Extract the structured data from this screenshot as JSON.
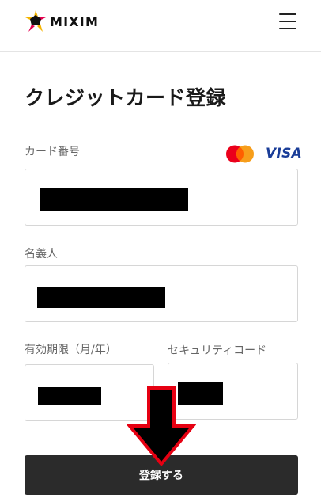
{
  "header": {
    "brand_name": "MIXIM",
    "menu_icon": "hamburger-menu-icon"
  },
  "page": {
    "title": "クレジットカード登録"
  },
  "form": {
    "card_number": {
      "label": "カード番号",
      "value": ""
    },
    "card_brands": {
      "mastercard_icon": "mastercard-logo",
      "visa_label": "VISA"
    },
    "holder_name": {
      "label": "名義人",
      "value": ""
    },
    "expiry": {
      "label": "有効期限（月/年）",
      "value": ""
    },
    "security_code": {
      "label": "セキュリティコード",
      "value": ""
    },
    "submit_label": "登録する"
  },
  "annotations": {
    "arrow": "red-outlined-down-arrow"
  },
  "colors": {
    "button_bg": "#2b2b2b",
    "logo_red": "#e5004f",
    "logo_yellow": "#f5b400",
    "mastercard_red": "#eb001b",
    "mastercard_orange": "#f79e1b",
    "visa_blue": "#1a3d98",
    "arrow_outline": "#e60012"
  }
}
